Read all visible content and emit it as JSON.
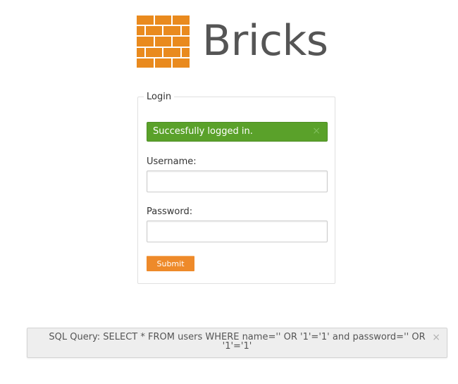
{
  "logo": {
    "text": "Bricks",
    "icon": "brick-wall-icon",
    "color": "#e98a1e"
  },
  "login": {
    "legend": "Login",
    "alert": {
      "message": "Succesfully logged in.",
      "close_symbol": "×",
      "color": "#5aa12a"
    },
    "username_label": "Username:",
    "username_value": "",
    "password_label": "Password:",
    "password_value": "",
    "submit_label": "Submit",
    "submit_color": "#ee8a2a"
  },
  "sql_notice": {
    "text": "SQL Query: SELECT * FROM users WHERE name='' OR '1'='1' and password='' OR '1'='1'",
    "close_symbol": "×"
  }
}
